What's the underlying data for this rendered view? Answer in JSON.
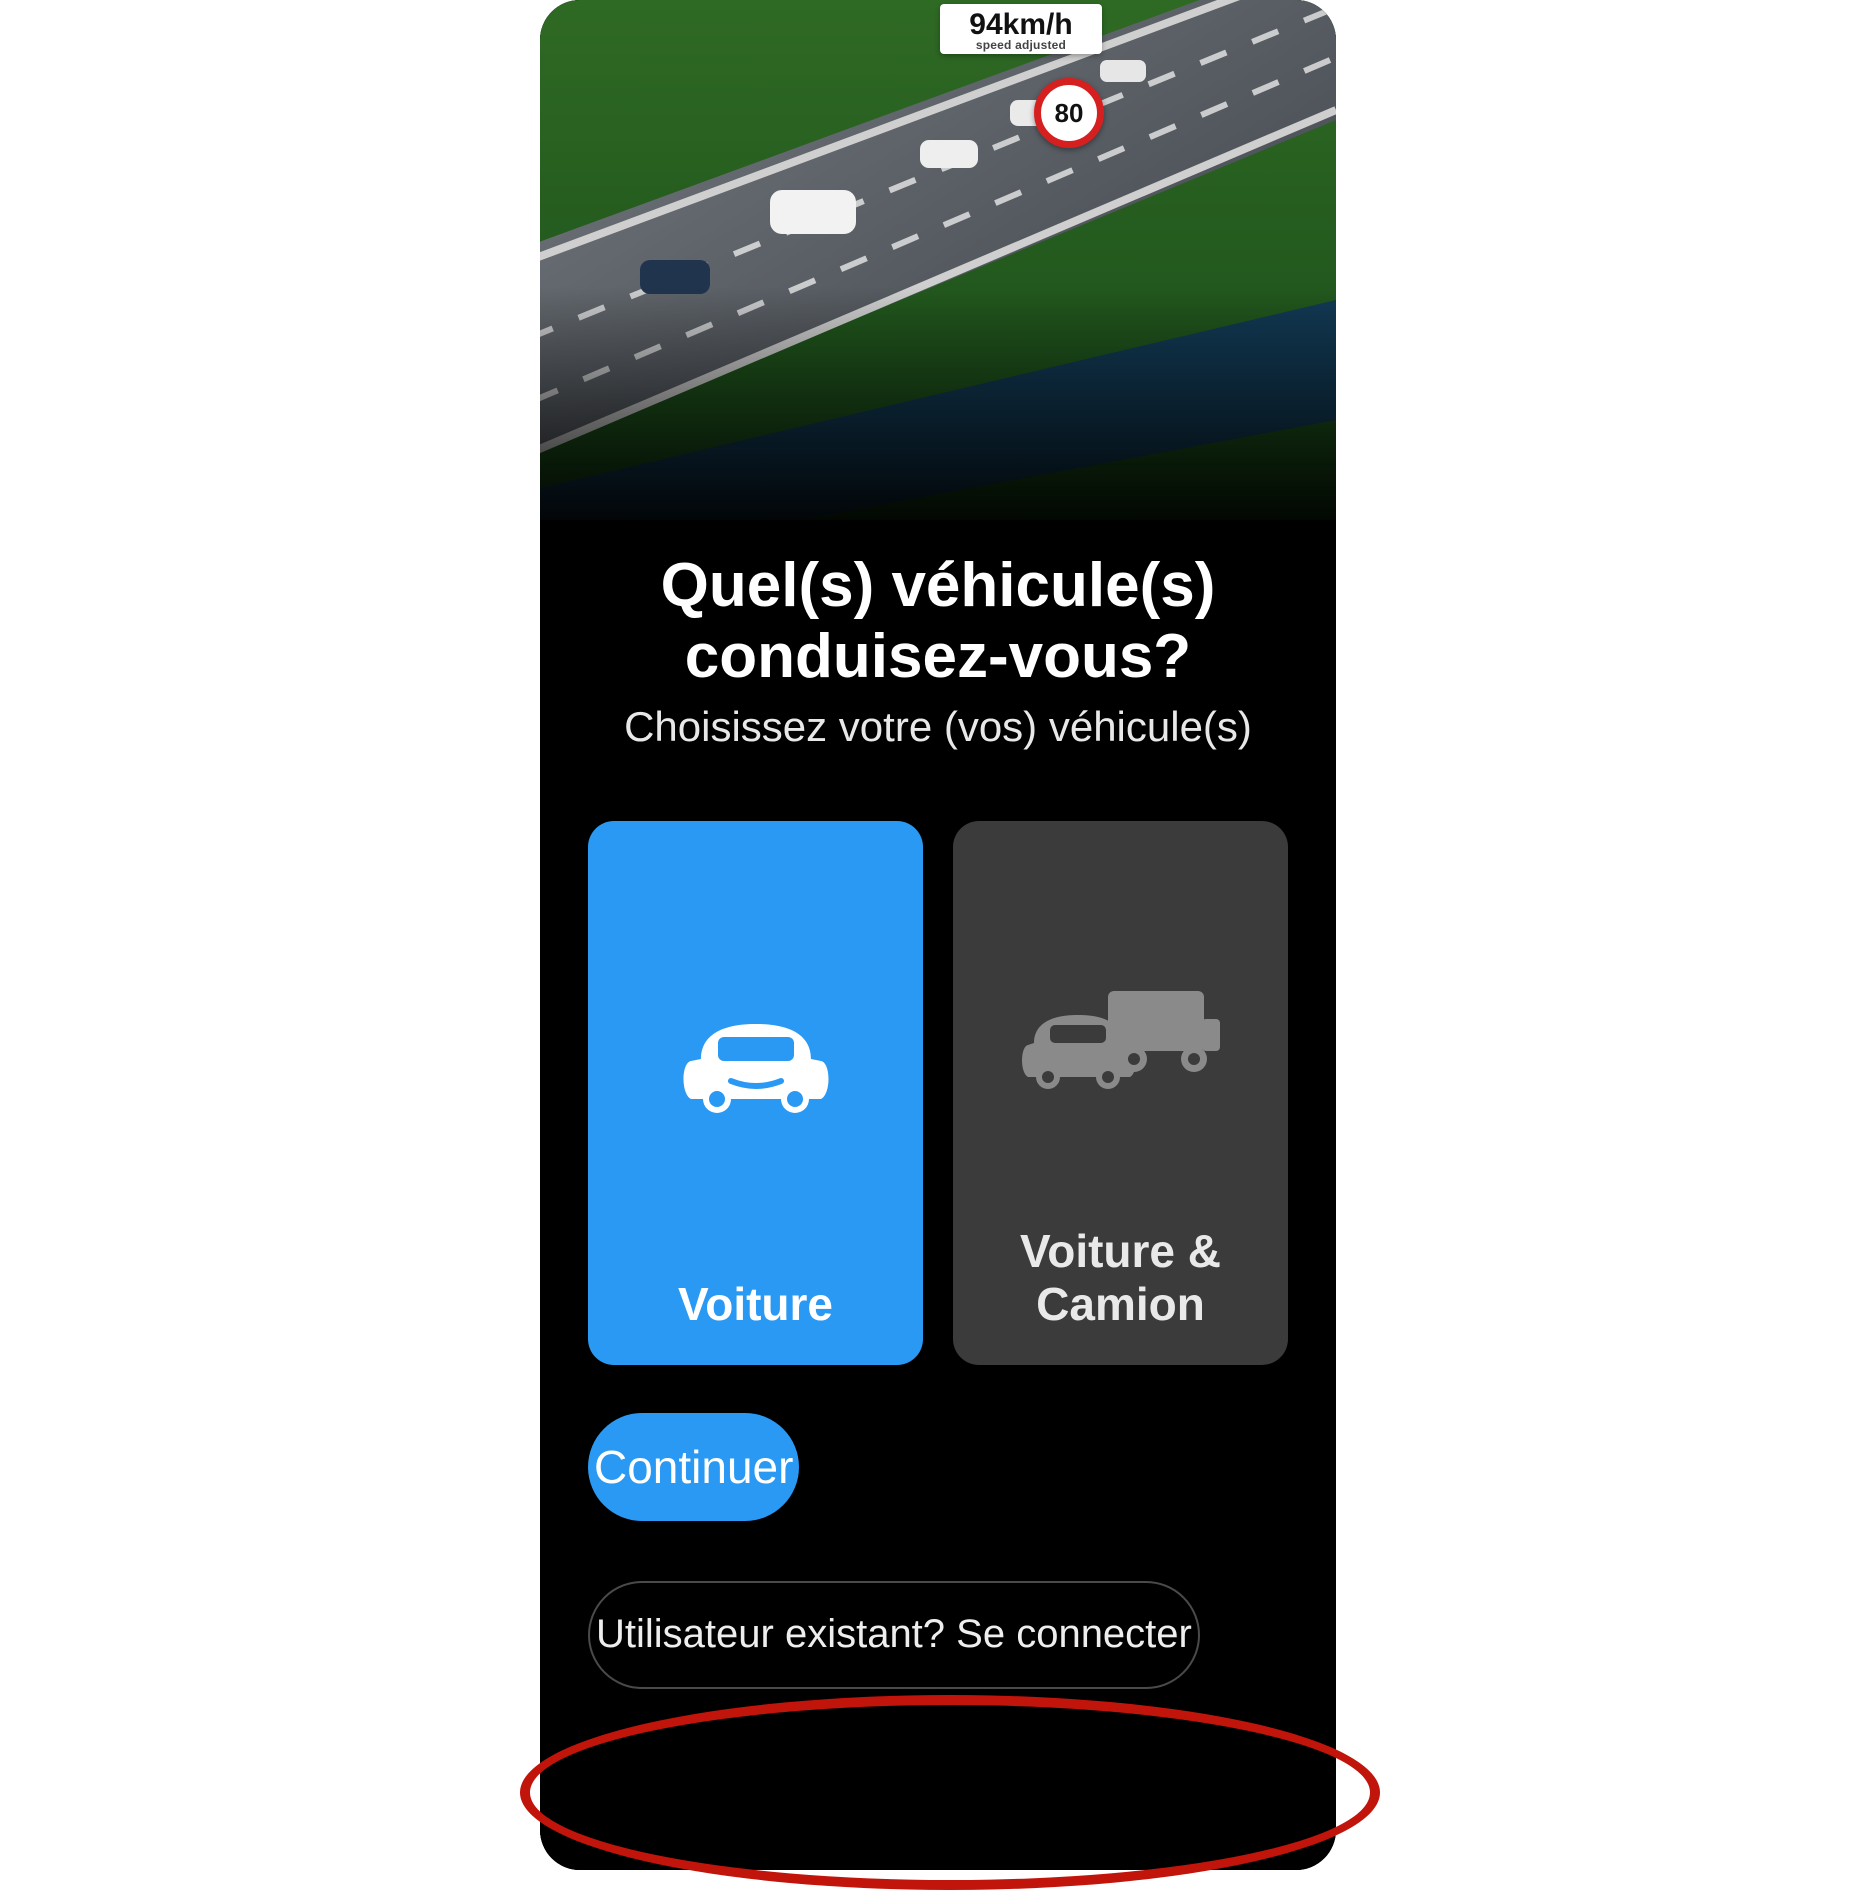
{
  "hero": {
    "speed_value": "94km/h",
    "speed_caption": "speed adjusted",
    "speed_limit": "80"
  },
  "title_line1": "Quel(s) véhicule(s)",
  "title_line2": "conduisez-vous?",
  "subtitle": "Choisissez votre (vos) véhicule(s)",
  "cards": {
    "car": {
      "label": "Voiture",
      "selected": true
    },
    "truck": {
      "label": "Voiture & Camion",
      "selected": false
    }
  },
  "continue_label": "Continuer",
  "signin_label": "Utilisateur existant? Se connecter",
  "colors": {
    "accent": "#2a99f3",
    "highlight": "#c1140a"
  }
}
